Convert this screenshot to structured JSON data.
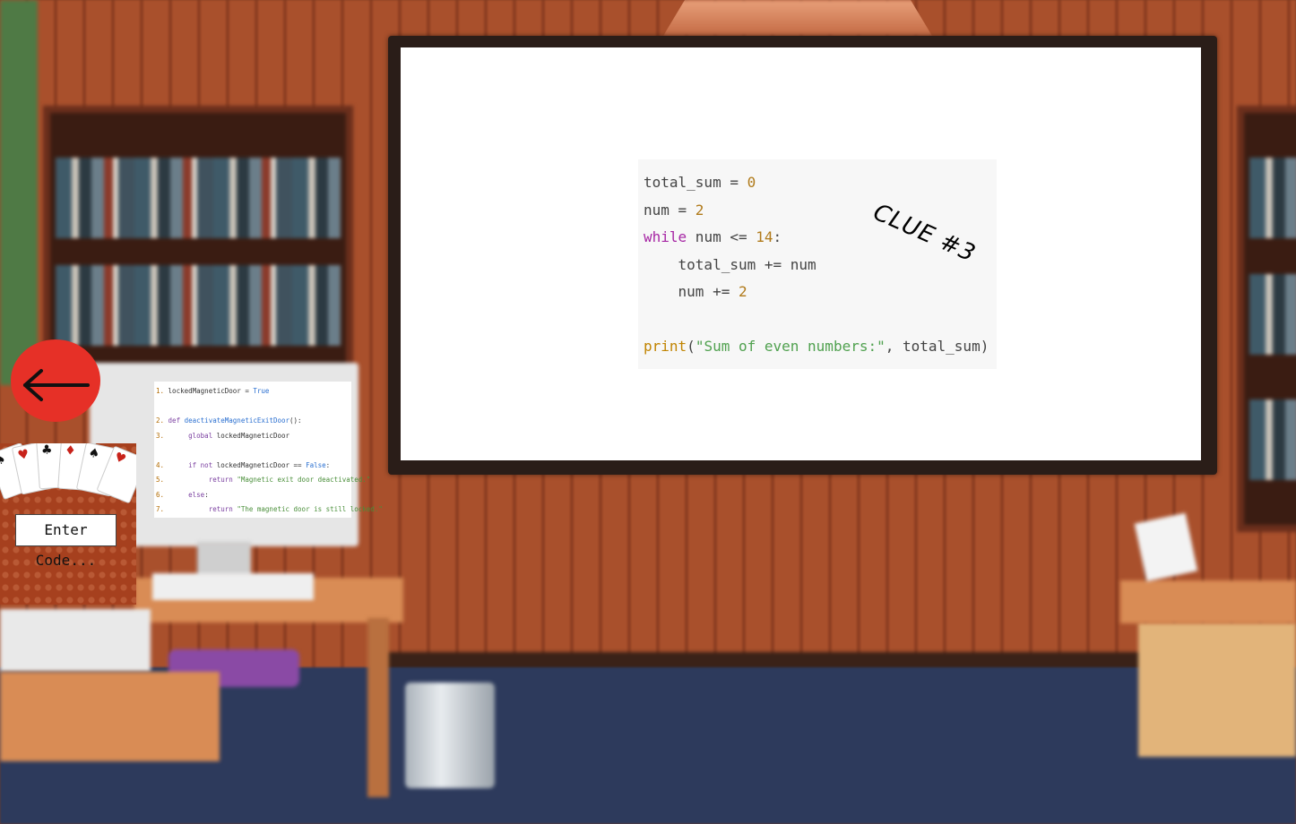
{
  "scene": {
    "name": "escape-room-classroom",
    "colors": {
      "wall": "#a9502c",
      "floor": "#2d3a5c",
      "back_button": "#e63027",
      "board": "#ffffff"
    }
  },
  "whiteboard": {
    "clue_label": "CLUE #3",
    "code_lines": [
      {
        "parts": [
          {
            "t": "total_sum = ",
            "c": "plain"
          },
          {
            "t": "0",
            "c": "num"
          }
        ]
      },
      {
        "parts": [
          {
            "t": "num = ",
            "c": "plain"
          },
          {
            "t": "2",
            "c": "num"
          }
        ]
      },
      {
        "parts": [
          {
            "t": "while",
            "c": "kw"
          },
          {
            "t": " num <= ",
            "c": "plain"
          },
          {
            "t": "14",
            "c": "num"
          },
          {
            "t": ":",
            "c": "plain"
          }
        ]
      },
      {
        "parts": [
          {
            "t": "    total_sum += num",
            "c": "plain"
          }
        ]
      },
      {
        "parts": [
          {
            "t": "    num += ",
            "c": "plain"
          },
          {
            "t": "2",
            "c": "num"
          }
        ]
      },
      {
        "parts": [
          {
            "t": "",
            "c": "plain"
          }
        ]
      },
      {
        "parts": [
          {
            "t": "print",
            "c": "fn"
          },
          {
            "t": "(",
            "c": "plain"
          },
          {
            "t": "\"Sum of even numbers:\"",
            "c": "str"
          },
          {
            "t": ", total_sum)",
            "c": "plain"
          }
        ]
      }
    ]
  },
  "navigation": {
    "back_icon": "left-arrow-icon"
  },
  "computer_clue": {
    "lines": [
      {
        "parts": [
          {
            "t": "1. ",
            "c": "ln"
          },
          {
            "t": "lockedMagneticDoor = ",
            "c": "plain"
          },
          {
            "t": "True",
            "c": "bool"
          }
        ]
      },
      {
        "parts": [
          {
            "t": "",
            "c": "plain"
          }
        ]
      },
      {
        "parts": [
          {
            "t": "2. ",
            "c": "ln"
          },
          {
            "t": "def ",
            "c": "kw"
          },
          {
            "t": "deactivateMagneticExitDoor",
            "c": "fn"
          },
          {
            "t": "():",
            "c": "plain"
          }
        ]
      },
      {
        "parts": [
          {
            "t": "3. ",
            "c": "ln"
          },
          {
            "t": "     ",
            "c": "plain"
          },
          {
            "t": "global ",
            "c": "kw"
          },
          {
            "t": "lockedMagneticDoor",
            "c": "plain"
          }
        ]
      },
      {
        "parts": [
          {
            "t": "",
            "c": "plain"
          }
        ]
      },
      {
        "parts": [
          {
            "t": "4. ",
            "c": "ln"
          },
          {
            "t": "     ",
            "c": "plain"
          },
          {
            "t": "if not ",
            "c": "kw"
          },
          {
            "t": "lockedMagneticDoor == ",
            "c": "plain"
          },
          {
            "t": "False",
            "c": "bool"
          },
          {
            "t": ":",
            "c": "plain"
          }
        ]
      },
      {
        "parts": [
          {
            "t": "5. ",
            "c": "ln"
          },
          {
            "t": "          ",
            "c": "plain"
          },
          {
            "t": "return ",
            "c": "kw"
          },
          {
            "t": "\"Magnetic exit door deactivated.\"",
            "c": "str"
          }
        ]
      },
      {
        "parts": [
          {
            "t": "6. ",
            "c": "ln"
          },
          {
            "t": "     ",
            "c": "plain"
          },
          {
            "t": "else",
            "c": "kw"
          },
          {
            "t": ":",
            "c": "plain"
          }
        ]
      },
      {
        "parts": [
          {
            "t": "7. ",
            "c": "ln"
          },
          {
            "t": "          ",
            "c": "plain"
          },
          {
            "t": "return ",
            "c": "kw"
          },
          {
            "t": "\"The magnetic door is still locked.\"",
            "c": "str"
          }
        ]
      }
    ]
  },
  "code_entry": {
    "button_label": "Enter Code...",
    "card_suits": [
      "♠",
      "♥",
      "♣",
      "♦",
      "♠",
      "♥"
    ]
  }
}
